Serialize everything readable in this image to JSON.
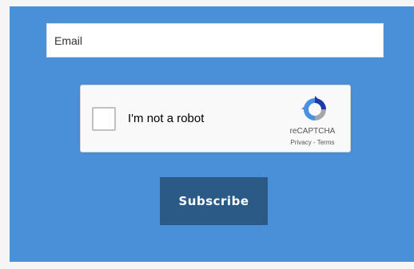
{
  "form": {
    "email_placeholder": "Email",
    "subscribe_label": "Subscribe"
  },
  "recaptcha": {
    "checkbox_label": "I'm not a robot",
    "brand": "reCAPTCHA",
    "privacy_link": "Privacy",
    "separator": " - ",
    "terms_link": "Terms",
    "logo_icon": "recaptcha-logo-icon"
  },
  "colors": {
    "panel_background": "#4a90d9",
    "button_background": "#2b5a86",
    "button_text": "#ffffff",
    "recaptcha_blue": "#4a90e2",
    "recaptcha_gray": "#a6a6a6",
    "recaptcha_dark_blue": "#1c3aa9"
  }
}
